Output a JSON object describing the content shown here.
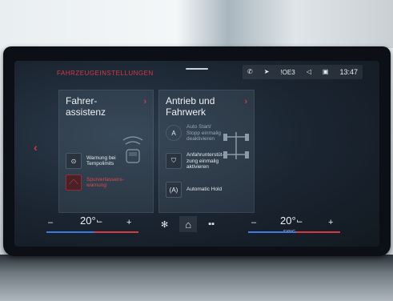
{
  "header": {
    "title": "FAHRZEUGEINSTELLUNGEN",
    "status": {
      "network": "!OE3",
      "time": "13:47"
    }
  },
  "card_driver_assist": {
    "title_line1": "Fahrer-",
    "title_line2": "assistenz",
    "items": [
      {
        "label_line1": "Warnung bei",
        "label_line2": "Tempolimits",
        "icon": "speed-limit-icon",
        "state": "normal"
      },
      {
        "label_line1": "Spurverlassens-",
        "label_line2": "warnung",
        "icon": "lane-departure-icon",
        "state": "active"
      }
    ]
  },
  "card_drive_chassis": {
    "title_line1": "Antrieb und",
    "title_line2": "Fahrwerk",
    "items": [
      {
        "label_lines": [
          "Auto Start/",
          "Stopp einmalig",
          "deaktivieren"
        ],
        "icon": "auto-start-stop-icon",
        "state": "dim"
      },
      {
        "label_lines": [
          "Anfahrunterstüt-",
          "zung einmalig",
          "aktivieren"
        ],
        "icon": "hill-start-icon",
        "state": "normal"
      },
      {
        "label_lines": [
          "Automatic Hold"
        ],
        "icon": "auto-hold-icon",
        "state": "normal"
      }
    ]
  },
  "climate": {
    "left_minus": "–",
    "left_temp": "20°",
    "left_plus": "+",
    "right_minus": "–",
    "right_temp": "20°",
    "right_plus": "+",
    "sync": "SYNC"
  },
  "colors": {
    "accent": "#d23a44",
    "text": "#e6ecf1",
    "cold": "#3d7be0",
    "hot": "#d23a44"
  }
}
